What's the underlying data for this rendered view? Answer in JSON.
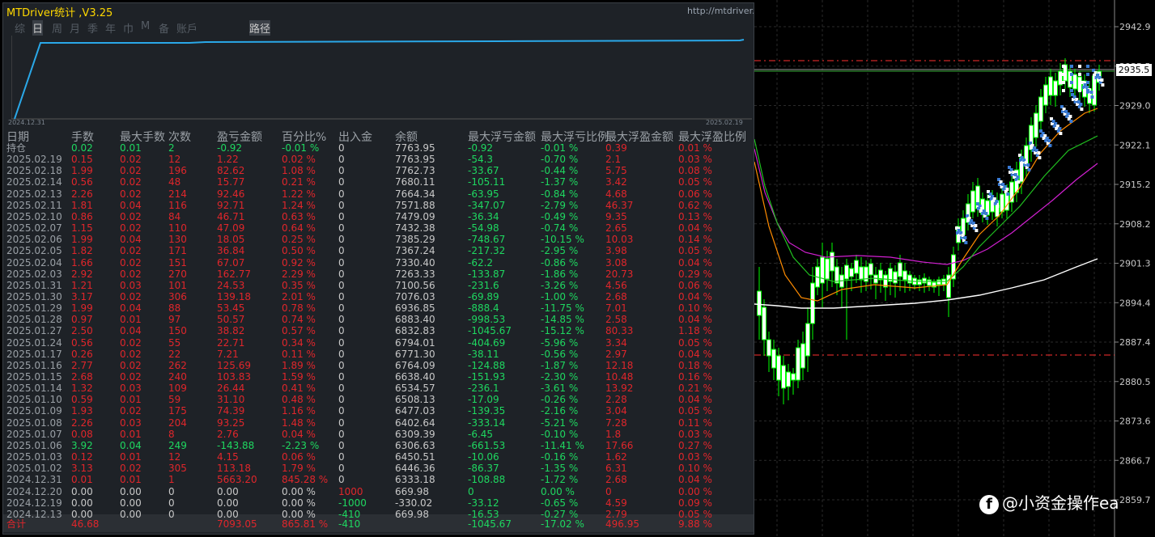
{
  "panel": {
    "title": "MTDriver统计 ,V3.25",
    "url": "http://mtdriver.cn",
    "tabs": [
      "综",
      "日",
      "周",
      "月",
      "季",
      "年",
      "巾",
      "M",
      "备",
      "账戶",
      "路径"
    ],
    "selected_tabs": [
      1,
      10
    ],
    "mini_start_date": "2024.12.31",
    "mini_end_date": "2025.02.19"
  },
  "table": {
    "headers": [
      "日期",
      "手数",
      "最大手数",
      "次数",
      "盈亏金额",
      "百分比%",
      "出入金",
      "余额",
      "最大浮亏金额",
      "最大浮亏比例",
      "最大浮盈金额",
      "最大浮盈比例"
    ],
    "rows": [
      [
        "持仓",
        "0.02",
        "0.01",
        "2",
        "-0.92",
        "-0.01 %",
        "0",
        "7763.95",
        "-0.92",
        "-0.01 %",
        "0.39",
        "0.01 %"
      ],
      [
        "2025.02.19",
        "0.15",
        "0.02",
        "12",
        "1.22",
        "0.02 %",
        "0",
        "7763.95",
        "-54.3",
        "-0.70 %",
        "2.1",
        "0.03 %"
      ],
      [
        "2025.02.18",
        "1.99",
        "0.02",
        "196",
        "82.62",
        "1.08 %",
        "0",
        "7762.73",
        "-33.67",
        "-0.44 %",
        "5.75",
        "0.08 %"
      ],
      [
        "2025.02.14",
        "0.56",
        "0.02",
        "48",
        "15.77",
        "0.21 %",
        "0",
        "7680.11",
        "-105.11",
        "-1.37 %",
        "3.42",
        "0.05 %"
      ],
      [
        "2025.02.13",
        "2.26",
        "0.02",
        "214",
        "92.46",
        "1.22 %",
        "0",
        "7664.34",
        "-63.95",
        "-0.84 %",
        "4.68",
        "0.06 %"
      ],
      [
        "2025.02.11",
        "1.81",
        "0.04",
        "116",
        "92.71",
        "1.24 %",
        "0",
        "7571.88",
        "-347.07",
        "-2.79 %",
        "46.37",
        "0.62 %"
      ],
      [
        "2025.02.10",
        "0.86",
        "0.02",
        "84",
        "46.71",
        "0.63 %",
        "0",
        "7479.09",
        "-36.34",
        "-0.49 %",
        "9.35",
        "0.13 %"
      ],
      [
        "2025.02.07",
        "1.15",
        "0.02",
        "110",
        "47.09",
        "0.64 %",
        "0",
        "7432.38",
        "-54.98",
        "-0.74 %",
        "2.65",
        "0.04 %"
      ],
      [
        "2025.02.06",
        "1.99",
        "0.04",
        "130",
        "18.05",
        "0.25 %",
        "0",
        "7385.29",
        "-748.67",
        "-10.15 %",
        "10.03",
        "0.14 %"
      ],
      [
        "2025.02.05",
        "1.82",
        "0.02",
        "171",
        "36.84",
        "0.50 %",
        "0",
        "7367.24",
        "-217.32",
        "-2.95 %",
        "3.98",
        "0.05 %"
      ],
      [
        "2025.02.04",
        "1.66",
        "0.02",
        "151",
        "67.07",
        "0.92 %",
        "0",
        "7330.40",
        "-62.2",
        "-0.86 %",
        "3.08",
        "0.04 %"
      ],
      [
        "2025.02.03",
        "2.92",
        "0.02",
        "270",
        "162.77",
        "2.29 %",
        "0",
        "7263.33",
        "-133.87",
        "-1.86 %",
        "20.73",
        "0.29 %"
      ],
      [
        "2025.01.31",
        "1.21",
        "0.03",
        "101",
        "24.53",
        "0.35 %",
        "0",
        "7100.56",
        "-231.6",
        "-3.26 %",
        "4.56",
        "0.06 %"
      ],
      [
        "2025.01.30",
        "3.17",
        "0.02",
        "306",
        "139.18",
        "2.01 %",
        "0",
        "7076.03",
        "-69.89",
        "-1.00 %",
        "2.68",
        "0.04 %"
      ],
      [
        "2025.01.29",
        "1.99",
        "0.04",
        "88",
        "53.45",
        "0.78 %",
        "0",
        "6936.85",
        "-888.4",
        "-11.75 %",
        "7.01",
        "0.10 %"
      ],
      [
        "2025.01.28",
        "0.97",
        "0.01",
        "97",
        "50.57",
        "0.74 %",
        "0",
        "6883.40",
        "-998.53",
        "-14.85 %",
        "2.58",
        "0.04 %"
      ],
      [
        "2025.01.27",
        "2.50",
        "0.04",
        "150",
        "38.82",
        "0.57 %",
        "0",
        "6832.83",
        "-1045.67",
        "-15.12 %",
        "80.33",
        "1.18 %"
      ],
      [
        "2025.01.24",
        "0.56",
        "0.02",
        "55",
        "22.71",
        "0.34 %",
        "0",
        "6794.01",
        "-404.69",
        "-5.96 %",
        "3.34",
        "0.05 %"
      ],
      [
        "2025.01.17",
        "0.26",
        "0.02",
        "22",
        "7.21",
        "0.11 %",
        "0",
        "6771.30",
        "-38.11",
        "-0.56 %",
        "2.97",
        "0.04 %"
      ],
      [
        "2025.01.16",
        "2.77",
        "0.02",
        "262",
        "125.69",
        "1.89 %",
        "0",
        "6764.09",
        "-124.88",
        "-1.87 %",
        "12.18",
        "0.18 %"
      ],
      [
        "2025.01.15",
        "2.68",
        "0.02",
        "240",
        "103.83",
        "1.59 %",
        "0",
        "6638.40",
        "-151.93",
        "-2.30 %",
        "10.48",
        "0.16 %"
      ],
      [
        "2025.01.14",
        "1.32",
        "0.03",
        "109",
        "26.44",
        "0.41 %",
        "0",
        "6534.57",
        "-236.1",
        "-3.61 %",
        "13.92",
        "0.21 %"
      ],
      [
        "2025.01.10",
        "0.59",
        "0.01",
        "59",
        "31.10",
        "0.48 %",
        "0",
        "6508.13",
        "-17.09",
        "-0.26 %",
        "2.28",
        "0.04 %"
      ],
      [
        "2025.01.09",
        "1.93",
        "0.02",
        "175",
        "74.39",
        "1.16 %",
        "0",
        "6477.03",
        "-139.35",
        "-2.16 %",
        "3.04",
        "0.05 %"
      ],
      [
        "2025.01.08",
        "2.26",
        "0.03",
        "204",
        "93.25",
        "1.48 %",
        "0",
        "6402.64",
        "-333.14",
        "-5.21 %",
        "7.28",
        "0.11 %"
      ],
      [
        "2025.01.07",
        "0.08",
        "0.01",
        "8",
        "2.76",
        "0.04 %",
        "0",
        "6309.39",
        "-6.45",
        "-0.10 %",
        "1.8",
        "0.03 %"
      ],
      [
        "2025.01.06",
        "3.92",
        "0.04",
        "249",
        "-143.88",
        "-2.23 %",
        "0",
        "6306.63",
        "-661.53",
        "-11.41 %",
        "17.66",
        "0.27 %"
      ],
      [
        "2025.01.03",
        "0.12",
        "0.01",
        "12",
        "4.15",
        "0.06 %",
        "0",
        "6450.51",
        "-10.06",
        "-0.16 %",
        "1.62",
        "0.03 %"
      ],
      [
        "2025.01.02",
        "3.13",
        "0.02",
        "305",
        "113.18",
        "1.79 %",
        "0",
        "6446.36",
        "-86.37",
        "-1.35 %",
        "6.31",
        "0.10 %"
      ],
      [
        "2024.12.31",
        "0.01",
        "0.01",
        "1",
        "5663.20",
        "845.28 %",
        "0",
        "6333.18",
        "-108.88",
        "-1.72 %",
        "2.68",
        "0.04 %"
      ],
      [
        "2024.12.20",
        "0.00",
        "0.00",
        "0",
        "0.00",
        "0.00 %",
        "1000",
        "669.98",
        "0",
        "0.00 %",
        "0",
        "0.00 %"
      ],
      [
        "2024.12.19",
        "0.00",
        "0.00",
        "0",
        "0.00",
        "0.00 %",
        "-1000",
        "-330.02",
        "-33.12",
        "-0.65 %",
        "4.59",
        "0.09 %"
      ],
      [
        "2024.12.13",
        "0.00",
        "0.00",
        "0",
        "0.00",
        "0.00 %",
        "-410",
        "669.98",
        "-16.53",
        "-0.27 %",
        "2.79",
        "0.05 %"
      ]
    ],
    "total": [
      "合计",
      "46.68",
      "",
      "",
      "7093.05",
      "865.81 %",
      "-410",
      "",
      "-1045.67",
      "-17.02 %",
      "496.95",
      "9.88 %"
    ]
  },
  "price_axis": {
    "labels": [
      "2942.9",
      "2935.5",
      "2929.0",
      "2922.1",
      "2915.2",
      "2908.2",
      "2901.3",
      "2894.4",
      "2887.4",
      "2880.5",
      "2873.6",
      "2866.7",
      "2859.7"
    ],
    "current_price": "2935.5"
  },
  "watermark": {
    "icon": "facebook-icon",
    "text": "@小资金操作ea"
  },
  "colors": {
    "up_candle": "#00ff00",
    "grid": "#2a2a2a",
    "dash_line": "#ff3030",
    "ma_white": "#ffffff",
    "ma_magenta": "#d020d0",
    "ma_green": "#20c020",
    "ma_orange": "#ff8c00",
    "mini_curve": "#2aa8e8"
  }
}
